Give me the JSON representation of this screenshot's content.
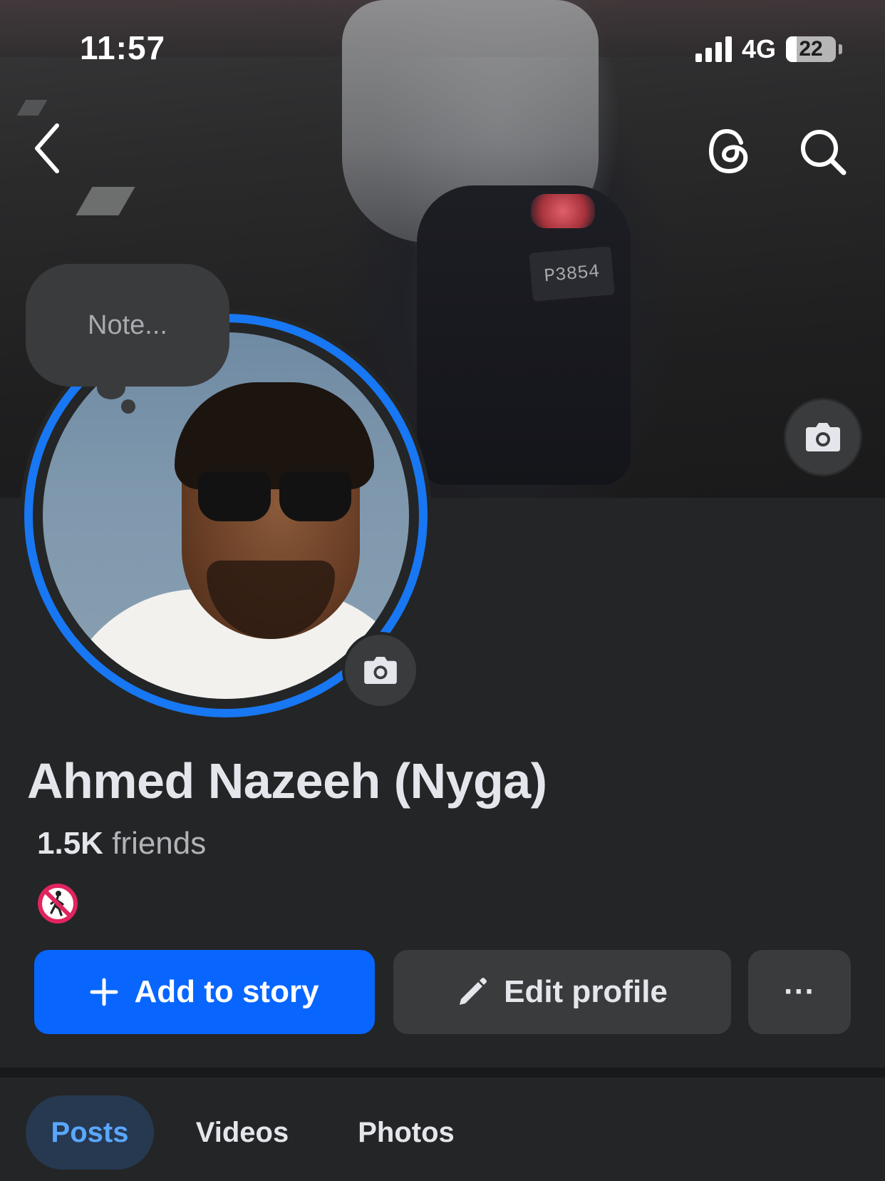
{
  "status_bar": {
    "time": "11:57",
    "network": "4G",
    "battery_level": "22",
    "battery_fraction": 0.22
  },
  "header": {
    "back_icon": "chevron-left-icon",
    "threads_icon": "threads-icon",
    "search_icon": "search-icon"
  },
  "cover": {
    "plate_text": "P3854",
    "camera_icon": "camera-icon"
  },
  "profile": {
    "note_placeholder": "Note...",
    "name": "Ahmed Nazeeh (Nyga)",
    "friends_count": "1.5K",
    "friends_label": "friends",
    "bio_emoji": "no-pedestrians-icon"
  },
  "actions": {
    "add_story_label": "Add to story",
    "edit_profile_label": "Edit profile",
    "more_label": "···"
  },
  "tabs": [
    {
      "label": "Posts",
      "selected": true
    },
    {
      "label": "Videos",
      "selected": false
    },
    {
      "label": "Photos",
      "selected": false
    }
  ],
  "colors": {
    "background": "#242526",
    "accent_blue": "#0866ff",
    "story_ring": "#1877f2",
    "secondary_button": "#3a3b3c",
    "selected_tab_bg": "#263951",
    "selected_tab_text": "#5aa7ff"
  }
}
